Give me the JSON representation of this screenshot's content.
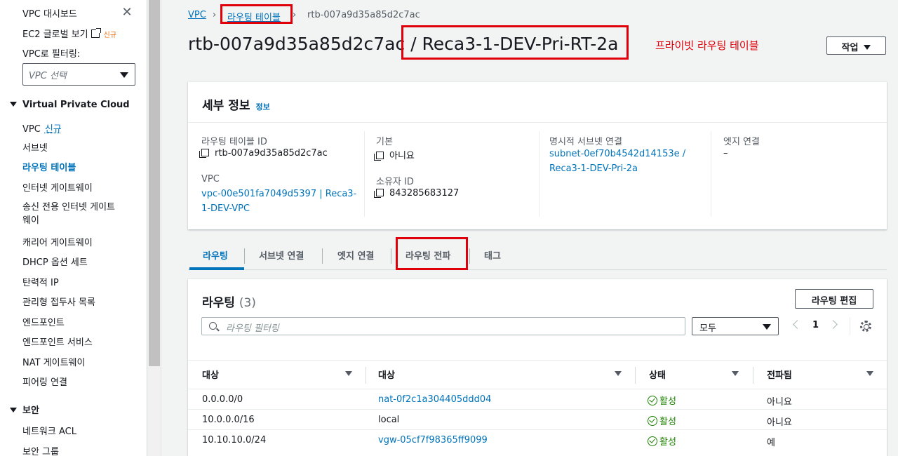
{
  "sidebar": {
    "dashboard": "VPC 대시보드",
    "ec2_global": "EC2 글로벌 보기",
    "ec2_badge": "신규",
    "filter_label": "VPC로 필터링:",
    "filter_placeholder": "VPC 선택",
    "section_vpc": "Virtual Private Cloud",
    "items": [
      {
        "label": "VPC",
        "badge": "신규"
      },
      {
        "label": "서브넷"
      },
      {
        "label": "라우팅 테이블"
      },
      {
        "label": "인터넷 게이트웨이"
      },
      {
        "label": "송신 전용 인터넷 게이트\n웨이"
      },
      {
        "label": "캐리어 게이트웨이"
      },
      {
        "label": "DHCP 옵션 세트"
      },
      {
        "label": "탄력적 IP"
      },
      {
        "label": "관리형 접두사 목록"
      },
      {
        "label": "엔드포인트"
      },
      {
        "label": "엔드포인트 서비스"
      },
      {
        "label": "NAT 게이트웨이"
      },
      {
        "label": "피어링 연결"
      }
    ],
    "section_security": "보안",
    "security_items": [
      {
        "label": "네트워크 ACL"
      },
      {
        "label": "보안 그룹"
      }
    ]
  },
  "breadcrumb": {
    "root": "VPC",
    "parent": "라우팅 테이블",
    "current": "rtb-007a9d35a85d2c7ac"
  },
  "header": {
    "title_id": "rtb-007a9d35a85d2c7ac",
    "title_name": "/ Reca3-1-DEV-Pri-RT-2a",
    "annotation": "프라이빗 라우팅 테이블",
    "actions_label": "작업"
  },
  "details": {
    "title": "세부 정보",
    "info": "정보",
    "rt_id_label": "라우팅 테이블 ID",
    "rt_id_value": "rtb-007a9d35a85d2c7ac",
    "vpc_label": "VPC",
    "vpc_value_line1": "vpc-00e501fa7049d5397 | Reca3-",
    "vpc_value_line2": "1-DEV-VPC",
    "main_label": "기본",
    "main_value": "아니요",
    "owner_label": "소유자 ID",
    "owner_value": "843285683127",
    "subnet_label": "명시적 서브넷 연결",
    "subnet_value_line1": "subnet-0ef70b4542d14153e /",
    "subnet_value_line2": "Reca3-1-DEV-Pri-2a",
    "edge_label": "엣지 연결",
    "edge_value": "–"
  },
  "tabs": [
    {
      "label": "라우팅"
    },
    {
      "label": "서브넷 연결"
    },
    {
      "label": "엣지 연결"
    },
    {
      "label": "라우팅 전파"
    },
    {
      "label": "태그"
    }
  ],
  "routes": {
    "title": "라우팅",
    "count": "(3)",
    "edit_label": "라우팅 편집",
    "search_placeholder": "라우팅 필터링",
    "filter_value": "모두",
    "page": "1",
    "columns": [
      "대상",
      "대상",
      "상태",
      "전파됨"
    ],
    "rows": [
      {
        "destination": "0.0.0.0/0",
        "target": "nat-0f2c1a304405ddd04",
        "status": "활성",
        "propagated": "아니요"
      },
      {
        "destination": "10.0.0.0/16",
        "target": "local",
        "status": "활성",
        "propagated": "아니요"
      },
      {
        "destination": "10.10.10.0/24",
        "target": "vgw-05cf7f98365ff9099",
        "status": "활성",
        "propagated": "예"
      }
    ]
  },
  "colors": {
    "link": "#0073bb",
    "highlight": "#e0000a",
    "success": "#1d8102"
  }
}
